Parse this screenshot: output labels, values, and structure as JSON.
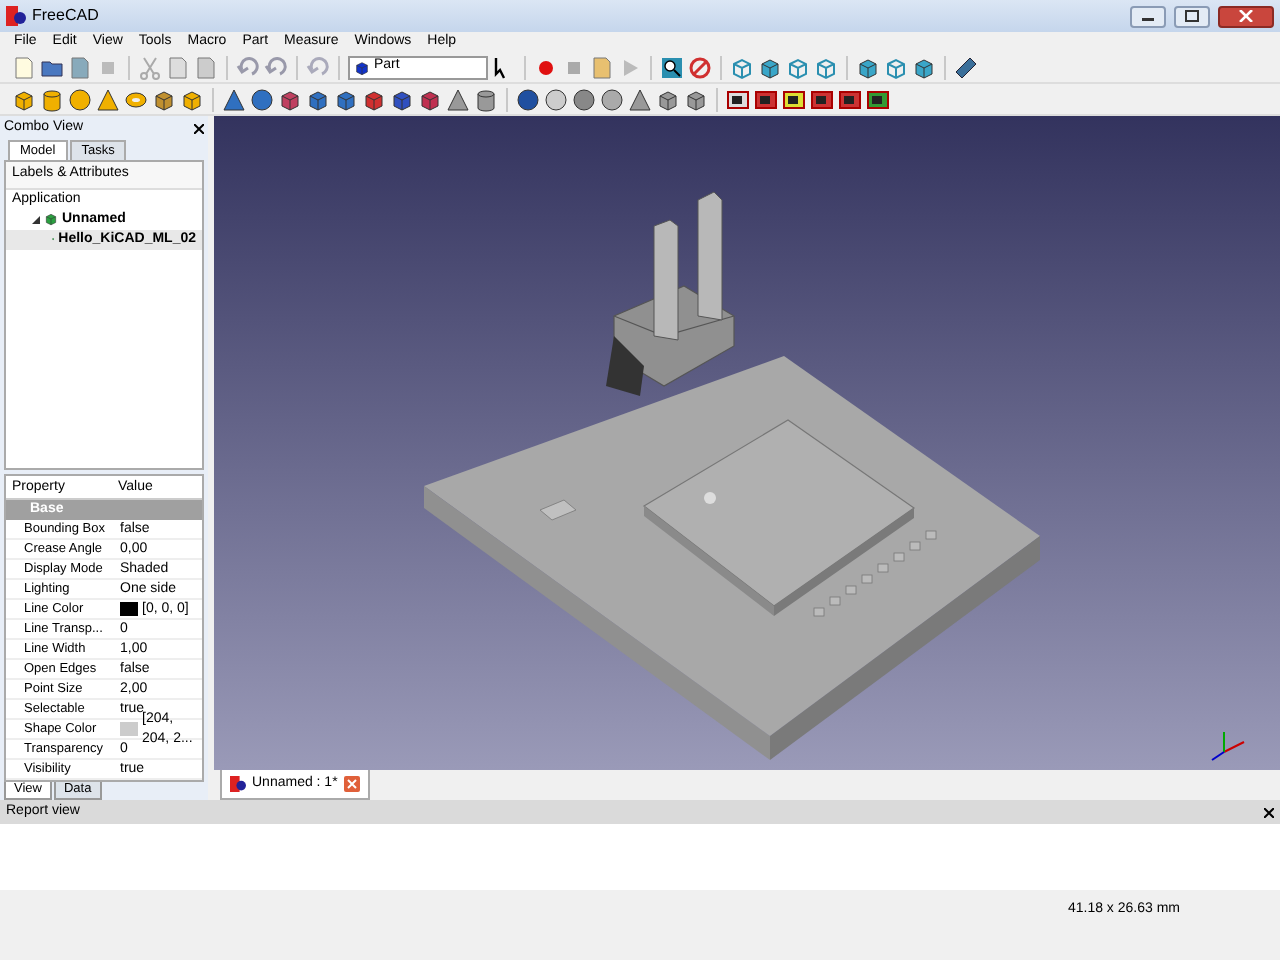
{
  "window": {
    "title": "FreeCAD"
  },
  "menu": [
    "File",
    "Edit",
    "View",
    "Tools",
    "Macro",
    "Part",
    "Measure",
    "Windows",
    "Help"
  ],
  "workbench_selector": {
    "value": "Part"
  },
  "combo_view": {
    "title": "Combo View",
    "tabs": [
      {
        "label": "Model",
        "selected": true
      },
      {
        "label": "Tasks",
        "selected": false
      }
    ],
    "tree": {
      "header": "Labels & Attributes",
      "root": "Application",
      "items": [
        {
          "label": "Unnamed",
          "expanded": true,
          "selected": false,
          "children": [
            {
              "label": "Hello_KiCAD_ML_02",
              "selected": true
            }
          ]
        }
      ]
    },
    "properties": {
      "columns": [
        "Property",
        "Value"
      ],
      "group": "Base",
      "rows": [
        {
          "name": "Bounding Box",
          "value": "false"
        },
        {
          "name": "Crease Angle",
          "value": "0,00"
        },
        {
          "name": "Display Mode",
          "value": "Shaded"
        },
        {
          "name": "Lighting",
          "value": "One side"
        },
        {
          "name": "Line Color",
          "value": "[0, 0, 0]",
          "color": "#000000"
        },
        {
          "name": "Line Transp...",
          "value": "0"
        },
        {
          "name": "Line Width",
          "value": "1,00"
        },
        {
          "name": "Open Edges",
          "value": "false"
        },
        {
          "name": "Point Size",
          "value": "2,00"
        },
        {
          "name": "Selectable",
          "value": "true"
        },
        {
          "name": "Shape Color",
          "value": "[204, 204, 2...",
          "color": "#cccccc"
        },
        {
          "name": "Transparency",
          "value": "0"
        },
        {
          "name": "Visibility",
          "value": "true"
        }
      ]
    },
    "bottom_tabs": [
      {
        "label": "View",
        "selected": true
      },
      {
        "label": "Data",
        "selected": false
      }
    ]
  },
  "document_tabs": [
    {
      "label": "Unnamed : 1*",
      "selected": true
    }
  ],
  "report_view": {
    "title": "Report view"
  },
  "status_bar": {
    "text": "41.18 x 26.63 mm"
  }
}
